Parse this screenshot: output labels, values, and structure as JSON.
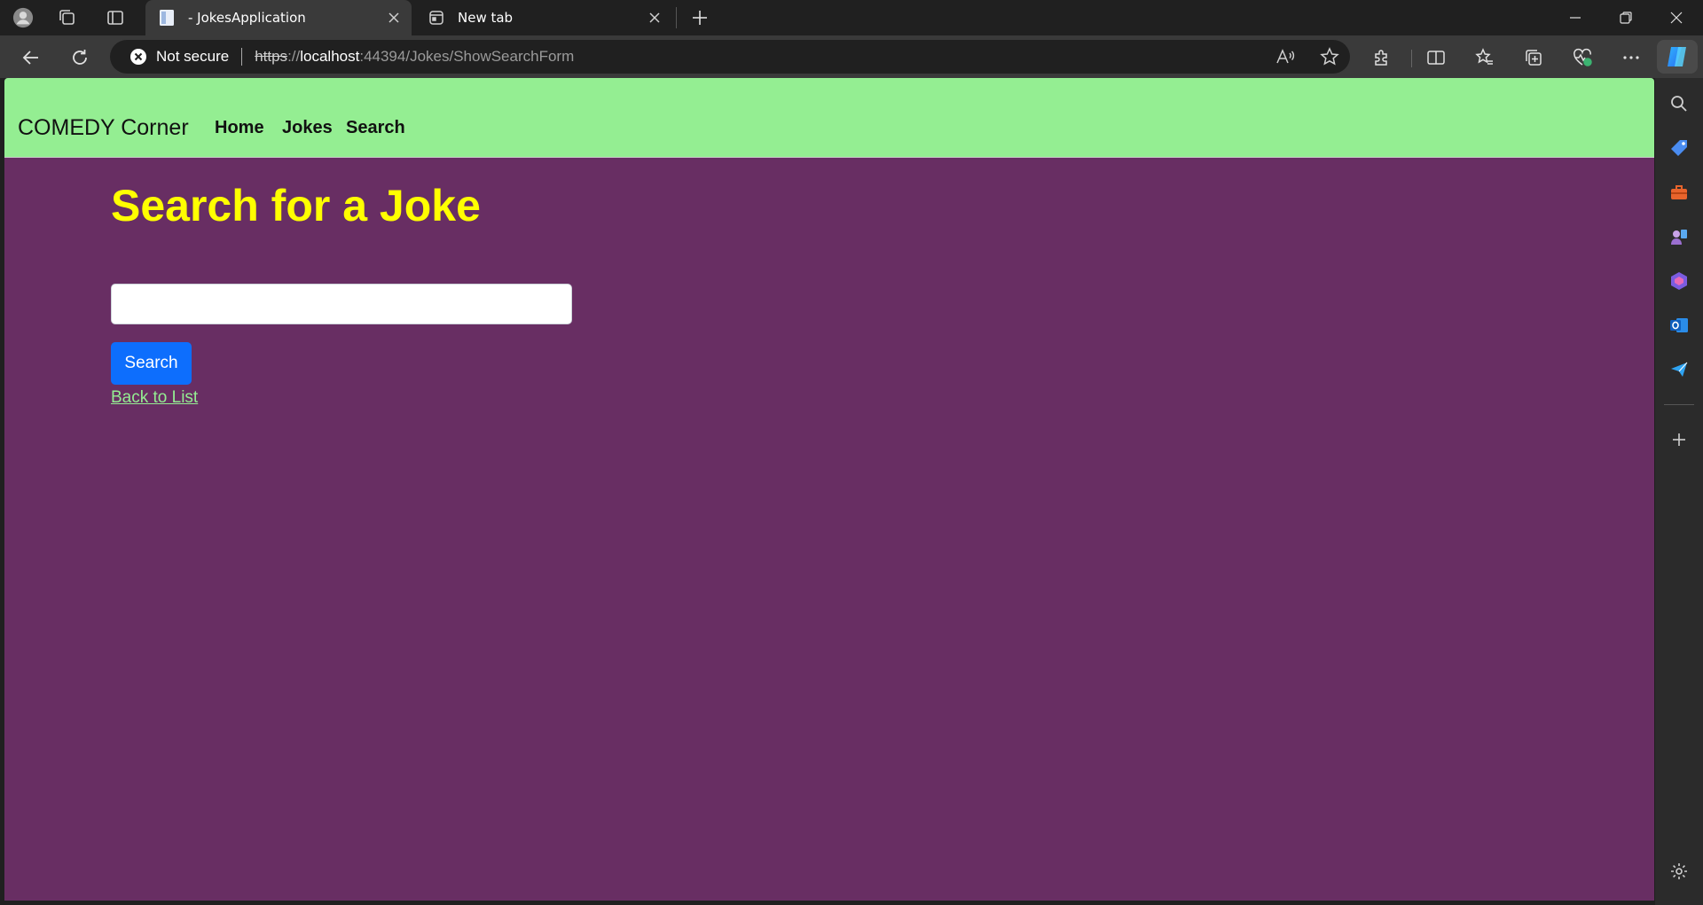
{
  "browser": {
    "tabs": [
      {
        "label": "- JokesApplication",
        "active": true
      },
      {
        "label": "New tab",
        "active": false
      }
    ],
    "security_label": "Not secure",
    "url": {
      "scheme": "https",
      "separator": "://",
      "host": "localhost",
      "path": ":44394/Jokes/ShowSearchForm"
    },
    "icons": {
      "profile": "profile-icon",
      "workspaces": "workspaces-icon",
      "tab_actions": "vertical-tabs-icon",
      "new_tab": "plus-icon",
      "back": "back-arrow-icon",
      "refresh": "refresh-icon",
      "read_aloud": "read-aloud-icon",
      "favorite": "star-icon",
      "extensions": "puzzle-icon",
      "split_screen": "split-screen-icon",
      "favorites_bar": "favorites-icon",
      "collections": "collections-icon",
      "browser_essentials": "heart-pulse-icon",
      "more": "more-icon",
      "copilot": "copilot-icon"
    },
    "sidebar_icons": [
      "search-icon",
      "shopping-tag-icon",
      "toolbox-icon",
      "games-icon",
      "office-icon",
      "outlook-icon",
      "send-icon",
      "add-icon",
      "settings-icon"
    ]
  },
  "site": {
    "brand": "COMEDY Corner",
    "nav": [
      "Home",
      "Jokes",
      "Search"
    ],
    "colors": {
      "nav_bg": "#94ee92",
      "page_bg": "#682e63",
      "title": "#ffff00",
      "button": "#0d6efd",
      "link": "#94ee92"
    }
  },
  "page": {
    "title": "Search for a Joke",
    "search_value": "",
    "search_button": "Search",
    "back_link": "Back to List"
  }
}
